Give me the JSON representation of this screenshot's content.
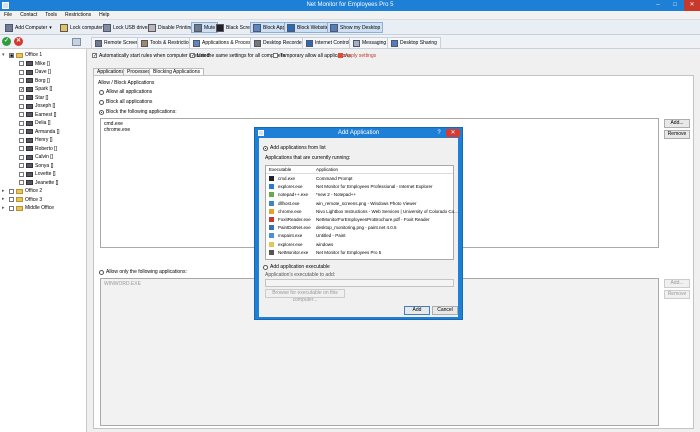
{
  "window": {
    "title": "Net Monitor for Employees Pro 5",
    "minimize": "–",
    "maximize": "□",
    "close": "✕"
  },
  "menu": [
    "File",
    "Contact",
    "Tools",
    "Restrictions",
    "Help"
  ],
  "toolbar": {
    "add_computer": "Add Computer",
    "lock_computer": "Lock computer",
    "lock_usb": "Lock USB drives",
    "disable_printing": "Disable Printing",
    "mute": "Mute",
    "black_screen": "Black Screen",
    "block_apps": "Block Apps",
    "block_websites": "Block Websites",
    "show_desktop": "Show my Desktop"
  },
  "tree": {
    "groups": [
      {
        "name": "Office 1",
        "expanded": true,
        "children": [
          "Mike []",
          "Dave []",
          "Borg []",
          "Spark []",
          "Star []",
          "Joseph []",
          "Earnest []",
          "Delia []",
          "Armanda []",
          "Henry []",
          "Roberto []",
          "Calvin []",
          "Sonya []",
          "Lovette []",
          "Jeanette []"
        ]
      },
      {
        "name": "Office 2",
        "expanded": false,
        "children": []
      },
      {
        "name": "Office 3",
        "expanded": false,
        "children": []
      },
      {
        "name": "Middle Office",
        "expanded": false,
        "children": []
      }
    ],
    "checked_child": "Spark []"
  },
  "main_tabs": [
    "Remote Screens",
    "Tools & Restrictions",
    "Applications & Processes",
    "Desktop Recorder",
    "Internet Control",
    "Messaging",
    "Desktop Sharing"
  ],
  "active_main_tab": "Applications & Processes",
  "options": {
    "auto_start": "Automatically start rules when computer is started",
    "same_settings": "Use the same settings for all computers.",
    "temp_allow": "Temporary allow all applications",
    "apply": "Apply settings"
  },
  "sub_tabs": [
    "Applications",
    "Processes",
    "Blocking Applications"
  ],
  "active_sub_tab": "Blocking Applications",
  "blocking": {
    "group_label": "Allow / Block Applications",
    "allow_all": "Allow all applications",
    "block_all": "Block all applications",
    "block_following": "Block the following applications:",
    "blocked_list": [
      "cmd.exe",
      "chrome.exe"
    ],
    "add_btn": "Add...",
    "remove_btn": "Remove",
    "allow_only": "Allow only the following applications:",
    "allowed_list": [
      "WINWORD.EXE"
    ],
    "add_btn2": "Add...",
    "remove_btn2": "Remove"
  },
  "dialog": {
    "title": "Add Application",
    "help": "?",
    "close": "✕",
    "from_list": "Add applications from list",
    "running_label": "Applications that are currently running:",
    "col_exe": "Executable",
    "col_app": "Application",
    "apps": [
      {
        "exe": "cmd.exe",
        "app": "Command Prompt",
        "color": "#222222"
      },
      {
        "exe": "explorer.exe",
        "app": "Net Monitor for Employees Professional - Internet Explorer",
        "color": "#2a7bd6"
      },
      {
        "exe": "notepad++.exe",
        "app": "*new 2 - Notepad++",
        "color": "#6aa84f"
      },
      {
        "exe": "dllhost.exe",
        "app": "win_remote_screens.png - Windows Photo Viewer",
        "color": "#3d85c6"
      },
      {
        "exe": "chrome.exe",
        "app": "Nivo Lightbox Instructions - Web Services | University of Colorado Co...",
        "color": "#e0a526"
      },
      {
        "exe": "FoxitReader.exe",
        "app": "NetMonitorForEmployeesProBrochure.pdf - Foxit Reader",
        "color": "#cc3333"
      },
      {
        "exe": "PaintDotNet.exe",
        "app": "desktop_monitoring.png - paint.net 4.0.5",
        "color": "#3d6fb3"
      },
      {
        "exe": "mspaint.exe",
        "app": "Untitled - Paint",
        "color": "#4a90d9"
      },
      {
        "exe": "explorer.exe",
        "app": "windows",
        "color": "#e8c45a"
      },
      {
        "exe": "NetMonitor.exe",
        "app": "Net Monitor for Employees Pro 5",
        "color": "#555555"
      }
    ],
    "add_exe": "Add application executable",
    "exe_path_label": "Application's executable to add:",
    "browse": "Browse for executable on this computer...",
    "add": "Add",
    "cancel": "Cancel"
  }
}
